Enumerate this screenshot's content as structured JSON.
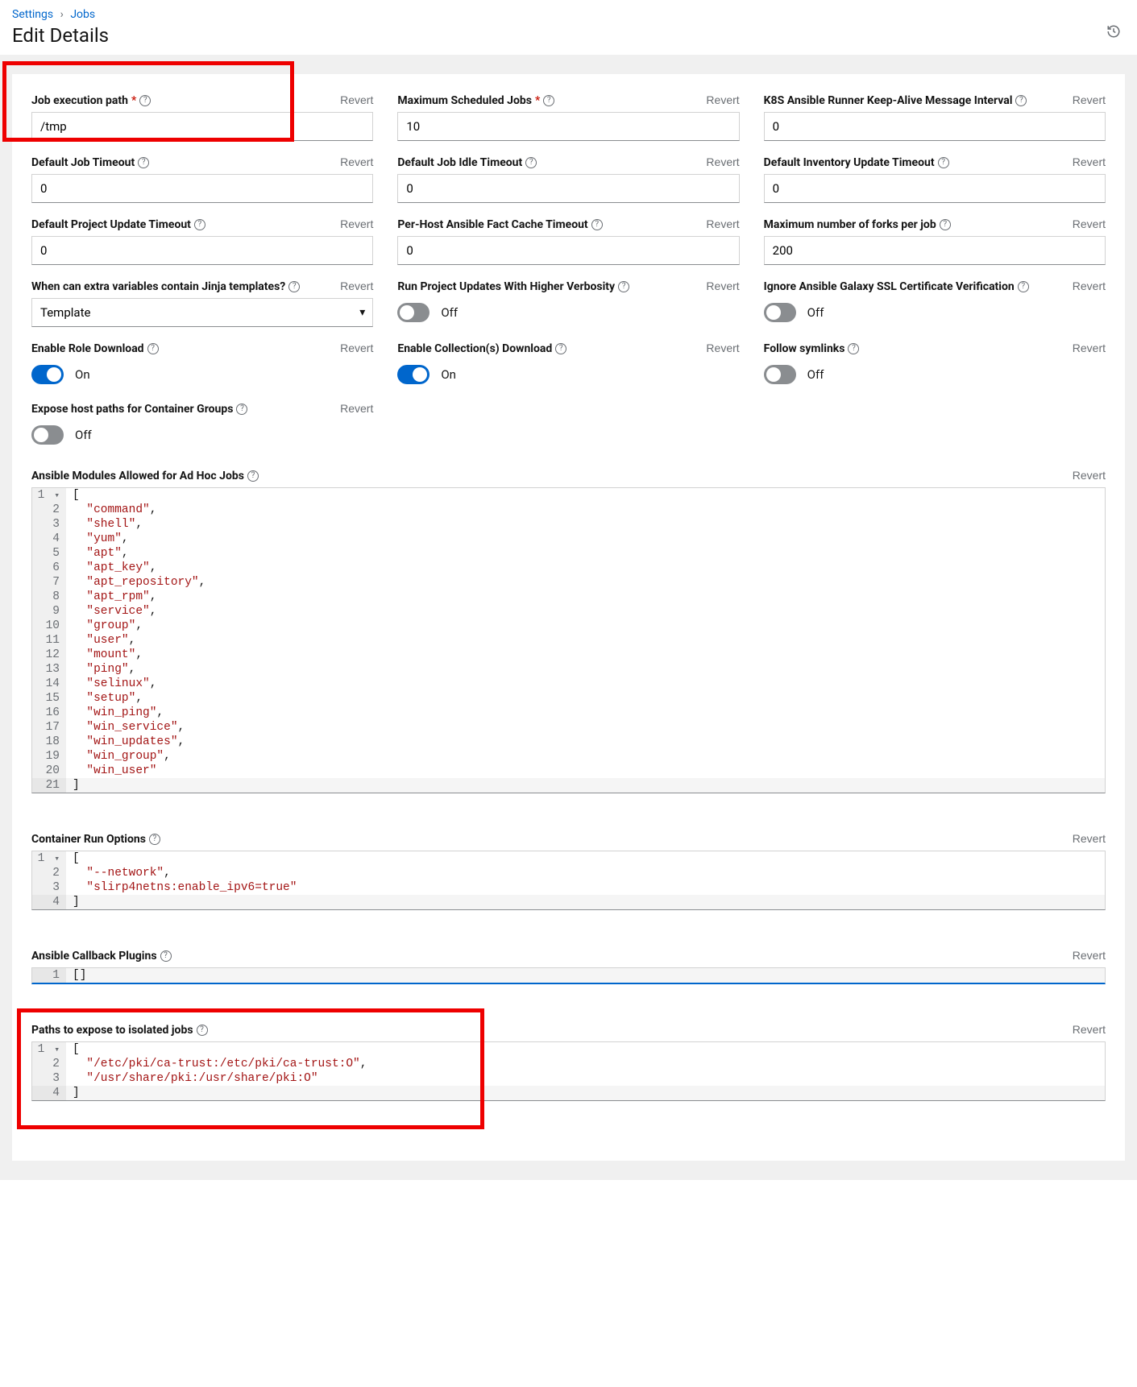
{
  "breadcrumb": {
    "settings": "Settings",
    "jobs": "Jobs"
  },
  "title": "Edit Details",
  "revert": "Revert",
  "on": "On",
  "off": "Off",
  "fields": {
    "jobExecPath": {
      "label": "Job execution path",
      "value": "/tmp",
      "required": true
    },
    "maxSched": {
      "label": "Maximum Scheduled Jobs",
      "value": "10",
      "required": true
    },
    "k8sKeepalive": {
      "label": "K8S Ansible Runner Keep-Alive Message Interval",
      "value": "0"
    },
    "defJobTimeout": {
      "label": "Default Job Timeout",
      "value": "0"
    },
    "defIdle": {
      "label": "Default Job Idle Timeout",
      "value": "0"
    },
    "defInvUpdate": {
      "label": "Default Inventory Update Timeout",
      "value": "0"
    },
    "defProjUpdate": {
      "label": "Default Project Update Timeout",
      "value": "0"
    },
    "perHostCache": {
      "label": "Per-Host Ansible Fact Cache Timeout",
      "value": "0"
    },
    "maxForks": {
      "label": "Maximum number of forks per job",
      "value": "200"
    },
    "jinja": {
      "label": "When can extra variables contain Jinja templates?",
      "value": "Template"
    },
    "runProjVerb": {
      "label": "Run Project Updates With Higher Verbosity",
      "on": false
    },
    "ignoreGalaxy": {
      "label": "Ignore Ansible Galaxy SSL Certificate Verification",
      "on": false
    },
    "enableRole": {
      "label": "Enable Role Download",
      "on": true
    },
    "enableColl": {
      "label": "Enable Collection(s) Download",
      "on": true
    },
    "followSym": {
      "label": "Follow symlinks",
      "on": false
    },
    "exposeHost": {
      "label": "Expose host paths for Container Groups",
      "on": false
    },
    "adHocModules": {
      "label": "Ansible Modules Allowed for Ad Hoc Jobs",
      "lines": [
        "[",
        "  \"command\",",
        "  \"shell\",",
        "  \"yum\",",
        "  \"apt\",",
        "  \"apt_key\",",
        "  \"apt_repository\",",
        "  \"apt_rpm\",",
        "  \"service\",",
        "  \"group\",",
        "  \"user\",",
        "  \"mount\",",
        "  \"ping\",",
        "  \"selinux\",",
        "  \"setup\",",
        "  \"win_ping\",",
        "  \"win_service\",",
        "  \"win_updates\",",
        "  \"win_group\",",
        "  \"win_user\"",
        "]"
      ]
    },
    "containerRun": {
      "label": "Container Run Options",
      "lines": [
        "[",
        "  \"--network\",",
        "  \"slirp4netns:enable_ipv6=true\"",
        "]"
      ]
    },
    "callbackPlug": {
      "label": "Ansible Callback Plugins",
      "lines": [
        "[]"
      ]
    },
    "isolatedPaths": {
      "label": "Paths to expose to isolated jobs",
      "lines": [
        "[",
        "  \"/etc/pki/ca-trust:/etc/pki/ca-trust:O\",",
        "  \"/usr/share/pki:/usr/share/pki:O\"",
        "]"
      ]
    }
  }
}
